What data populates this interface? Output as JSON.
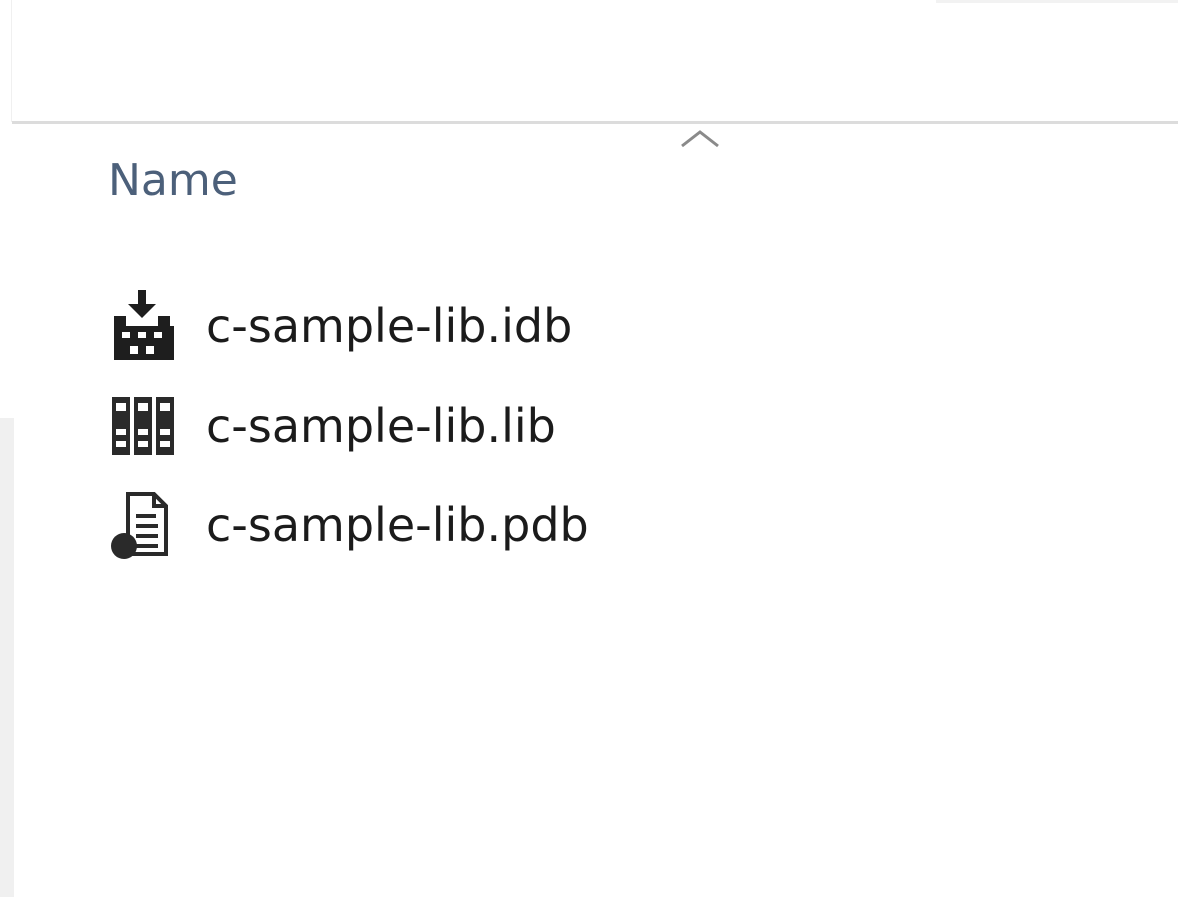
{
  "file_list": {
    "columns": [
      {
        "label": "Name",
        "sorted": "ascending"
      }
    ],
    "files": [
      {
        "name": "c-sample-lib.idb",
        "icon": "idb-file-icon"
      },
      {
        "name": "c-sample-lib.lib",
        "icon": "lib-file-icon"
      },
      {
        "name": "c-sample-lib.pdb",
        "icon": "pdb-file-icon"
      }
    ]
  },
  "colors": {
    "header_text": "#4c607a",
    "file_text": "#1b1b1b",
    "separator": "#dcdcdc"
  }
}
